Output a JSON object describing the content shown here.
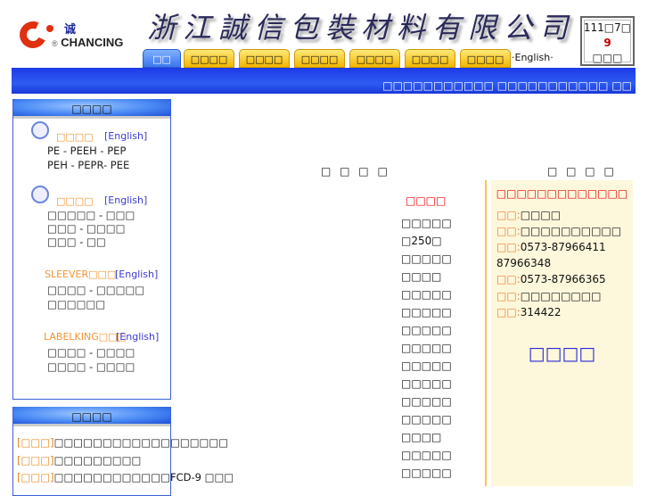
{
  "logo": {
    "cn": "诚",
    "en": "CHANCING",
    "mark": "®"
  },
  "banner": {
    "title": "浙江誠信包裝材料有限公司"
  },
  "date": {
    "line1": "111□7□",
    "day": "9",
    "weekday": "□□□"
  },
  "nav": {
    "tabs": [
      "□□",
      "□□□□",
      "□□□□",
      "□□□□",
      "□□□□",
      "□□□□",
      "□□□□"
    ],
    "english": "·English·"
  },
  "marquee": "□□□□□□□□□□□ □□□□□□□□□□□ □□",
  "products": {
    "header": "□□□□",
    "groups": [
      {
        "title": "□□□□",
        "english": "[English]",
        "lines": [
          "PE - PEEH - PEP",
          "PEH - PEPR- PEE"
        ]
      },
      {
        "title": "□□□□",
        "english": "[English]",
        "lines": [
          "□□□□□ - □□□",
          "□□□ - □□□□",
          "□□□ - □□"
        ]
      },
      {
        "title": "SLEEVER□□□",
        "english": "[English]",
        "lines": [
          "□□□□ - □□□□□",
          "□□□□□□"
        ]
      },
      {
        "title": "LABELKING□□□",
        "english": "[English]",
        "lines": [
          "□□□□ - □□□□",
          "□□□□ - □□□□"
        ]
      }
    ]
  },
  "news": {
    "header": "□□□□",
    "items": [
      {
        "tag": "[□□□]",
        "text": "□□□□□□□□□□□□□□□□□□"
      },
      {
        "tag": "[□□□]",
        "text": "□□□□□□□□□"
      },
      {
        "tag": "[□□□]",
        "text": "□□□□□□□□□□□□FCD-9 □□□"
      }
    ]
  },
  "center": {
    "header": "□ □ □ □",
    "title": "□□□□",
    "items": [
      "□□□□□",
      "□250□",
      "□□□□□",
      "□□□□",
      "□□□□□",
      "□□□□□",
      "□□□□□",
      "□□□□□",
      "□□□□□",
      "□□□□□",
      "□□□□□",
      "□□□□□",
      "□□□□",
      "□□□□□",
      "□□□□□"
    ]
  },
  "contact": {
    "header": "□ □ □ □",
    "title": "□□□□□□□□□□□□□",
    "rows": [
      {
        "label": "□□:",
        "value": "□□□□"
      },
      {
        "label": "□□:",
        "value": "□□□□□□□□□□"
      },
      {
        "label": "□□:",
        "value": "0573-87966411"
      },
      {
        "label": "",
        "value": "87966348"
      },
      {
        "label": "□□:",
        "value": "0573-87966365"
      },
      {
        "label": "□□:",
        "value": "□□□□□□□□"
      },
      {
        "label": "□□:",
        "value": "314422"
      }
    ],
    "link": "□□□□"
  }
}
